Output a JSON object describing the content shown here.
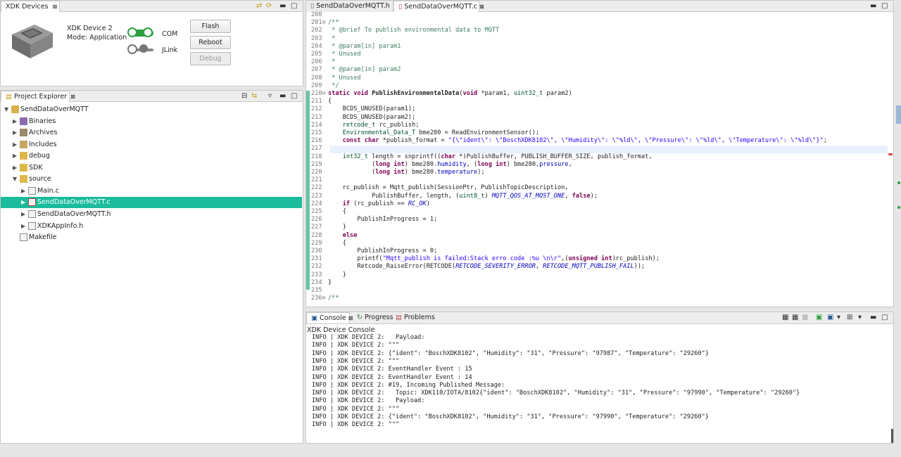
{
  "devices": {
    "tab": "XDK Devices",
    "device_name": "XDK Device 2",
    "mode": "Mode: Application",
    "com_label": "COM",
    "jlink_label": "JLink",
    "flash": "Flash",
    "reboot": "Reboot",
    "debug": "Debug"
  },
  "explorer": {
    "tab": "Project Explorer",
    "items": [
      {
        "label": "SendDataOverMQTT"
      },
      {
        "label": "Binaries"
      },
      {
        "label": "Archives"
      },
      {
        "label": "Includes"
      },
      {
        "label": "debug"
      },
      {
        "label": "SDK"
      },
      {
        "label": "source"
      },
      {
        "label": "Main.c"
      },
      {
        "label": "SendDataOverMQTT.c"
      },
      {
        "label": "SendDataOverMQTT.h"
      },
      {
        "label": "XDKAppInfo.h"
      },
      {
        "label": "Makefile"
      }
    ]
  },
  "editor": {
    "tabs": [
      "SendDataOverMQTT.h",
      "SendDataOverMQTT.c"
    ],
    "lines": [
      {
        "n": "200",
        "t": ""
      },
      {
        "n": "201⊖",
        "t": "/**"
      },
      {
        "n": "202",
        "t": " * @brief To publish environmental data to MQTT"
      },
      {
        "n": "203",
        "t": " *"
      },
      {
        "n": "204",
        "t": " * @param[in] param1"
      },
      {
        "n": "205",
        "t": " * Unused"
      },
      {
        "n": "206",
        "t": " *"
      },
      {
        "n": "207",
        "t": " * @param[in] param2"
      },
      {
        "n": "208",
        "t": " * Unused"
      },
      {
        "n": "209",
        "t": " */"
      },
      {
        "n": "210⊖",
        "t": "static void PublishEnvironmentalData(void *param1, uint32_t param2)"
      },
      {
        "n": "211",
        "t": "{"
      },
      {
        "n": "212",
        "t": "    BCDS_UNUSED(param1);"
      },
      {
        "n": "213",
        "t": "    BCDS_UNUSED(param2);"
      },
      {
        "n": "214",
        "t": "    retcode_t rc_publish;"
      },
      {
        "n": "215",
        "t": "    Environmental_Data_T bme280 = ReadEnvironmentSensor();"
      },
      {
        "n": "216",
        "t": "    const char *publish_format = \"{\\\"ident\\\": \\\"BoschXDK8102\\\", \\\"Humidity\\\": \\\"%ld\\\", \\\"Pressure\\\": \\\"%ld\\\", \\\"Temperature\\\": \\\"%ld\\\"}\";"
      },
      {
        "n": "217",
        "t": ""
      },
      {
        "n": "218",
        "t": "    int32_t length = snprintf((char *)PublishBuffer, PUBLISH_BUFFER_SIZE, publish_format,"
      },
      {
        "n": "219",
        "t": "            (long int) bme280.humidity, (long int) bme280.pressure,"
      },
      {
        "n": "220",
        "t": "            (long int) bme280.temperature);"
      },
      {
        "n": "221",
        "t": ""
      },
      {
        "n": "222",
        "t": "    rc_publish = Mqtt_publish(SessionPtr, PublishTopicDescription,"
      },
      {
        "n": "223",
        "t": "            PublishBuffer, length, (uint8_t) MQTT_QOS_AT_MOST_ONE, false);"
      },
      {
        "n": "224",
        "t": "    if (rc_publish == RC_OK)"
      },
      {
        "n": "225",
        "t": "    {"
      },
      {
        "n": "226",
        "t": "        PublishInProgress = 1;"
      },
      {
        "n": "227",
        "t": "    }"
      },
      {
        "n": "228",
        "t": "    else"
      },
      {
        "n": "229",
        "t": "    {"
      },
      {
        "n": "230",
        "t": "        PublishInProgress = 0;"
      },
      {
        "n": "231",
        "t": "        printf(\"Mqtt_publish is failed:Stack erro code :%u \\n\\r\",(unsigned int)rc_publish);"
      },
      {
        "n": "232",
        "t": "        Retcode_RaiseError(RETCODE(RETCODE_SEVERITY_ERROR, RETCODE_MQTT_PUBLISH_FAIL));"
      },
      {
        "n": "233",
        "t": "    }"
      },
      {
        "n": "234",
        "t": "}"
      },
      {
        "n": "235",
        "t": ""
      },
      {
        "n": "236⊖",
        "t": "/**"
      }
    ]
  },
  "console": {
    "tabs": [
      "Console",
      "Progress",
      "Problems"
    ],
    "title": "XDK Device Console",
    "lines": [
      "INFO | XDK DEVICE 2:   Payload:",
      "INFO | XDK DEVICE 2: \"\"\"",
      "INFO | XDK DEVICE 2: {\"ident\": \"BoschXDK8102\", \"Humidity\": \"31\", \"Pressure\": \"97987\", \"Temperature\": \"29260\"}",
      "INFO | XDK DEVICE 2: \"\"\"",
      "INFO | XDK DEVICE 2: EventHandler Event : 15",
      "INFO | XDK DEVICE 2: EventHandler Event : 14",
      "INFO | XDK DEVICE 2: #19, Incoming Published Message:",
      "INFO | XDK DEVICE 2:   Topic: XDK110/IOTA/8102{\"ident\": \"BoschXDK8102\", \"Humidity\": \"31\", \"Pressure\": \"97990\", \"Temperature\": \"29260\"}",
      "INFO | XDK DEVICE 2:   Payload:",
      "INFO | XDK DEVICE 2: \"\"\"",
      "INFO | XDK DEVICE 2: {\"ident\": \"BoschXDK8102\", \"Humidity\": \"31\", \"Pressure\": \"97990\", \"Temperature\": \"29260\"}",
      "INFO | XDK DEVICE 2: \"\"\""
    ]
  },
  "colors": {
    "selection": "#1abc9c",
    "toggle_on": "#2e9e3e",
    "toggle_off": "#777777"
  }
}
